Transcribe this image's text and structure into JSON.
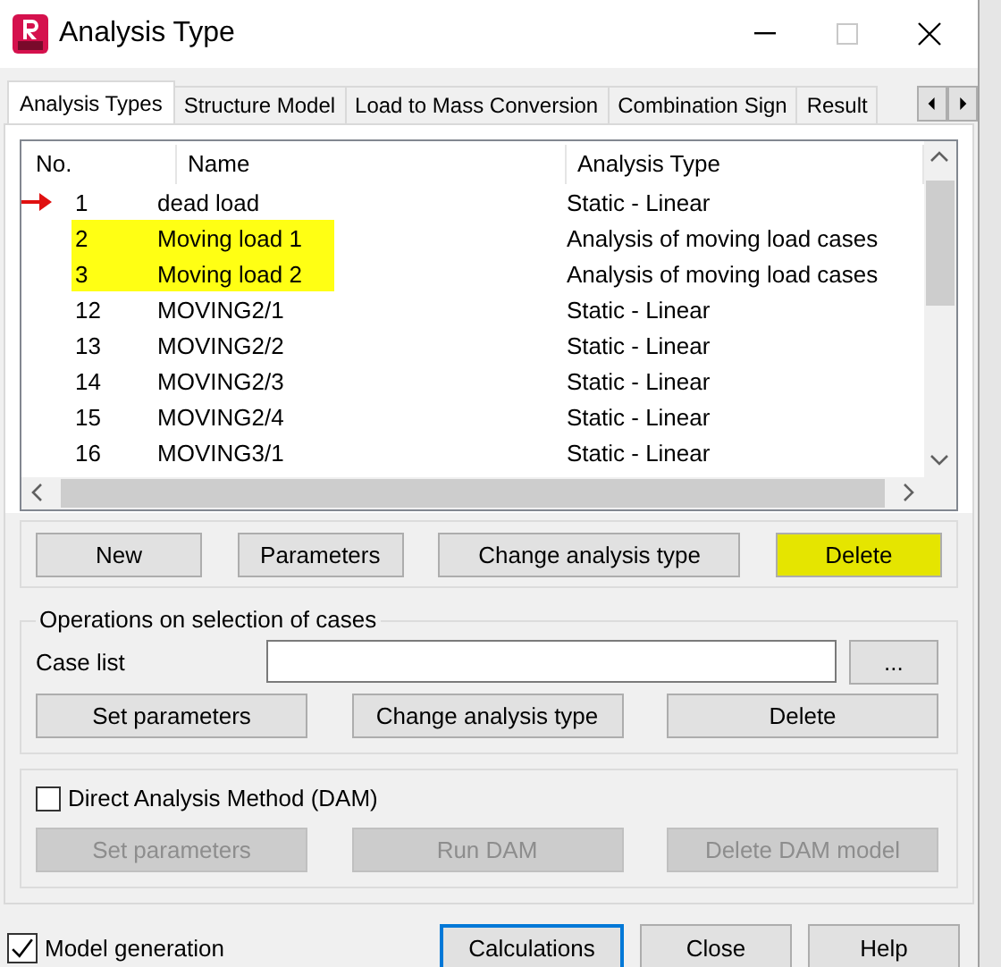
{
  "window": {
    "title": "Analysis Type"
  },
  "tabs": [
    {
      "label": "Analysis Types",
      "selected": true
    },
    {
      "label": "Structure Model",
      "selected": false
    },
    {
      "label": "Load to Mass Conversion",
      "selected": false
    },
    {
      "label": "Combination Sign",
      "selected": false
    },
    {
      "label": "Result",
      "selected": false
    }
  ],
  "cases": {
    "columns": [
      "No.",
      "Name",
      "Analysis Type"
    ],
    "rows": [
      {
        "no": "1",
        "name": "dead load",
        "type": "Static - Linear",
        "current": true,
        "highlighted": false
      },
      {
        "no": "2",
        "name": "Moving load 1",
        "type": "Analysis of moving load cases",
        "current": false,
        "highlighted": true
      },
      {
        "no": "3",
        "name": "Moving load 2",
        "type": "Analysis of moving load cases",
        "current": false,
        "highlighted": true
      },
      {
        "no": "12",
        "name": "MOVING2/1",
        "type": "Static - Linear",
        "current": false,
        "highlighted": false
      },
      {
        "no": "13",
        "name": "MOVING2/2",
        "type": "Static - Linear",
        "current": false,
        "highlighted": false
      },
      {
        "no": "14",
        "name": "MOVING2/3",
        "type": "Static - Linear",
        "current": false,
        "highlighted": false
      },
      {
        "no": "15",
        "name": "MOVING2/4",
        "type": "Static - Linear",
        "current": false,
        "highlighted": false
      },
      {
        "no": "16",
        "name": "MOVING3/1",
        "type": "Static - Linear",
        "current": false,
        "highlighted": false
      }
    ]
  },
  "buttons": [
    {
      "label": "New",
      "highlighted": false
    },
    {
      "label": "Parameters",
      "highlighted": false
    },
    {
      "label": "Change analysis type",
      "highlighted": false
    },
    {
      "label": "Delete",
      "highlighted": true
    }
  ],
  "operations": {
    "title": "Operations on selection of cases",
    "case_list_label": "Case list",
    "browse": "...",
    "buttons": [
      {
        "label": "Set parameters",
        "disabled": false
      },
      {
        "label": "Change analysis type",
        "disabled": false
      },
      {
        "label": "Delete",
        "disabled": false
      }
    ]
  },
  "dam": {
    "label": "Direct Analysis Method (DAM)",
    "checked": false,
    "buttons": [
      {
        "label": "Set parameters",
        "disabled": true
      },
      {
        "label": "Run DAM",
        "disabled": true
      },
      {
        "label": "Delete DAM model",
        "disabled": true
      }
    ]
  },
  "footer": {
    "model_generation": {
      "label": "Model generation",
      "checked": true
    },
    "buttons": [
      {
        "label": "Calculations",
        "default": true
      },
      {
        "label": "Close",
        "default": false
      },
      {
        "label": "Help",
        "default": false
      }
    ]
  }
}
